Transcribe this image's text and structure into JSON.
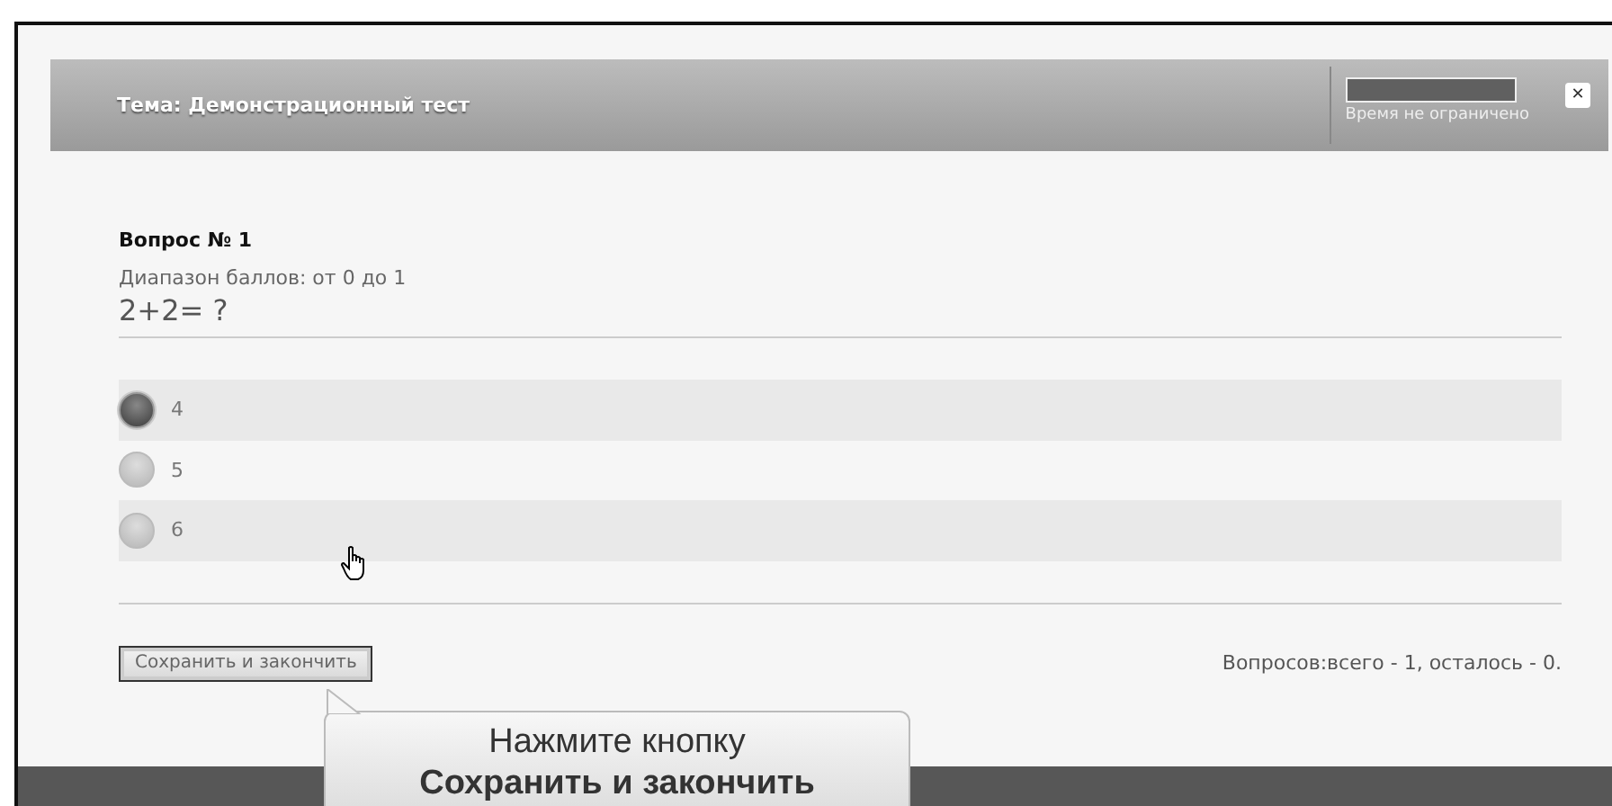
{
  "header": {
    "title": "Тема: Демонстрационный тест",
    "timer": {
      "level": 1,
      "label": "Время не ограничено"
    },
    "close": "✕"
  },
  "question": {
    "number": "Вопрос № 1",
    "score_range": "Диапазон баллов: от 0 до 1",
    "text": "2+2= ?"
  },
  "options": [
    {
      "label": "4",
      "selected": true
    },
    {
      "label": "5",
      "selected": false
    },
    {
      "label": "6",
      "selected": false
    }
  ],
  "footer": {
    "button": "Сохранить и закончить",
    "progress": "Вопросов:всего - 1, осталось - 0."
  },
  "tooltip": {
    "line_1": "Нажмите кнопку",
    "line_2": "Сохранить и закончить"
  }
}
